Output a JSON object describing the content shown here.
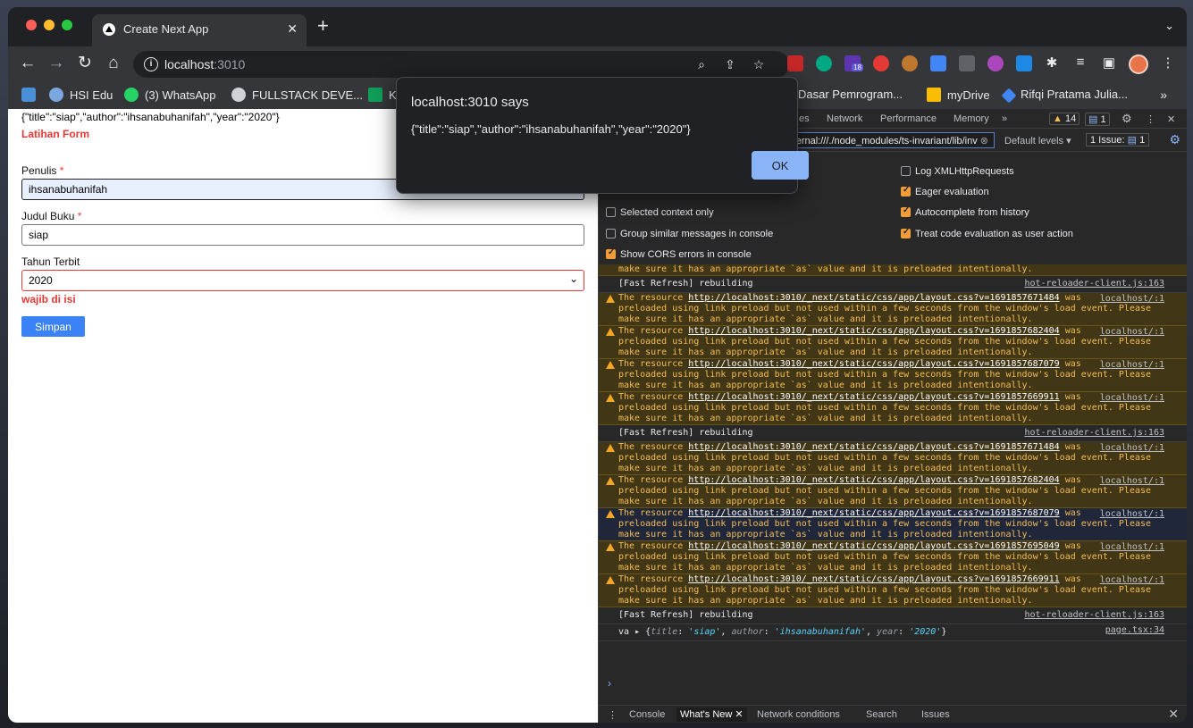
{
  "browser": {
    "tab_title": "Create Next App",
    "tab_close": "✕",
    "new_tab": "+",
    "tab_menu": "⌄",
    "url_host": "localhost",
    "url_port": ":3010",
    "ext_badge": "18",
    "bookmarks": [
      {
        "label": "",
        "color": "#4a90d9"
      },
      {
        "label": "HSI Edu",
        "color": "#7aa7e0"
      },
      {
        "label": "(3) WhatsApp",
        "color": "#25d366"
      },
      {
        "label": "FULLSTACK DEVE...",
        "color": "#cfd2d6"
      },
      {
        "label": "K",
        "color": "#0f9d58"
      },
      {
        "label": "Dasar Pemrogram...",
        "color": "#8e8e8e"
      },
      {
        "label": "myDrive",
        "color": "#fbbc04"
      },
      {
        "label": "Rifqi Pratama Julia...",
        "color": "#4285f4"
      }
    ],
    "bookmarks_more": "»"
  },
  "page": {
    "json_line": "{\"title\":\"siap\",\"author\":\"ihsanabuhanifah\",\"year\":\"2020\"}",
    "form_title": "Latihan Form",
    "penulis_label": "Penulis",
    "penulis_value": "ihsanabuhanifah",
    "judul_label": "Judul Buku",
    "judul_value": "siap",
    "tahun_label": "Tahun Terbit",
    "tahun_value": "2020",
    "required_mark": "*",
    "error_text": "wajib di isi",
    "save_label": "Simpan"
  },
  "dialog": {
    "title": "localhost:3010 says",
    "message": "{\"title\":\"siap\",\"author\":\"ihsanabuhanifah\",\"year\":\"2020\"}",
    "ok_label": "OK"
  },
  "devtools": {
    "tabs": [
      "es",
      "Network",
      "Performance",
      "Memory"
    ],
    "tabs_more": "»",
    "warn_count": "14",
    "msg_count": "1",
    "filter_value": "-internal:///./node_modules/ts-invariant/lib/inv",
    "levels": "Default levels ▾",
    "issue_label": "1 Issue:",
    "issue_count": "1",
    "settings_left": [
      "Selected context only",
      "Group similar messages in console",
      "Show CORS errors in console"
    ],
    "settings_right": [
      "Log XMLHttpRequests",
      "Eager evaluation",
      "Autocomplete from history",
      "Treat code evaluation as user action"
    ],
    "console": {
      "trunc_line": "make sure it has an appropriate `as` value and it is preloaded intentionally.",
      "refresh_text": "[Fast Refresh] rebuilding",
      "refresh_src": "hot-reloader-client.js:163",
      "warn_prefix": "The resource ",
      "warn_mid": " was",
      "warn_line2": "preloaded using link preload but not used within a few seconds from the window's load event. Please",
      "warn_line3": "make sure it has an appropriate `as` value and it is preloaded intentionally.",
      "warn_src": "localhost/:1",
      "urls": [
        "http://localhost:3010/_next/static/css/app/layout.css?v=1691857671484",
        "http://localhost:3010/_next/static/css/app/layout.css?v=1691857682404",
        "http://localhost:3010/_next/static/css/app/layout.css?v=1691857687079",
        "http://localhost:3010/_next/static/css/app/layout.css?v=1691857669911",
        "http://localhost:3010/_next/static/css/app/layout.css?v=1691857695049"
      ],
      "eval_var": "va",
      "eval_open": "{",
      "eval_k1": "title",
      "eval_v1": "'siap'",
      "eval_k2": "author",
      "eval_v2": "'ihsanabuhanifah'",
      "eval_k3": "year",
      "eval_v3": "'2020'",
      "eval_close": "}",
      "eval_src": "page.tsx:34",
      "prompt": "›"
    },
    "drawer_tabs": [
      "Console",
      "What's New",
      "Network conditions",
      "Search",
      "Issues"
    ],
    "drawer_close": "✕"
  }
}
